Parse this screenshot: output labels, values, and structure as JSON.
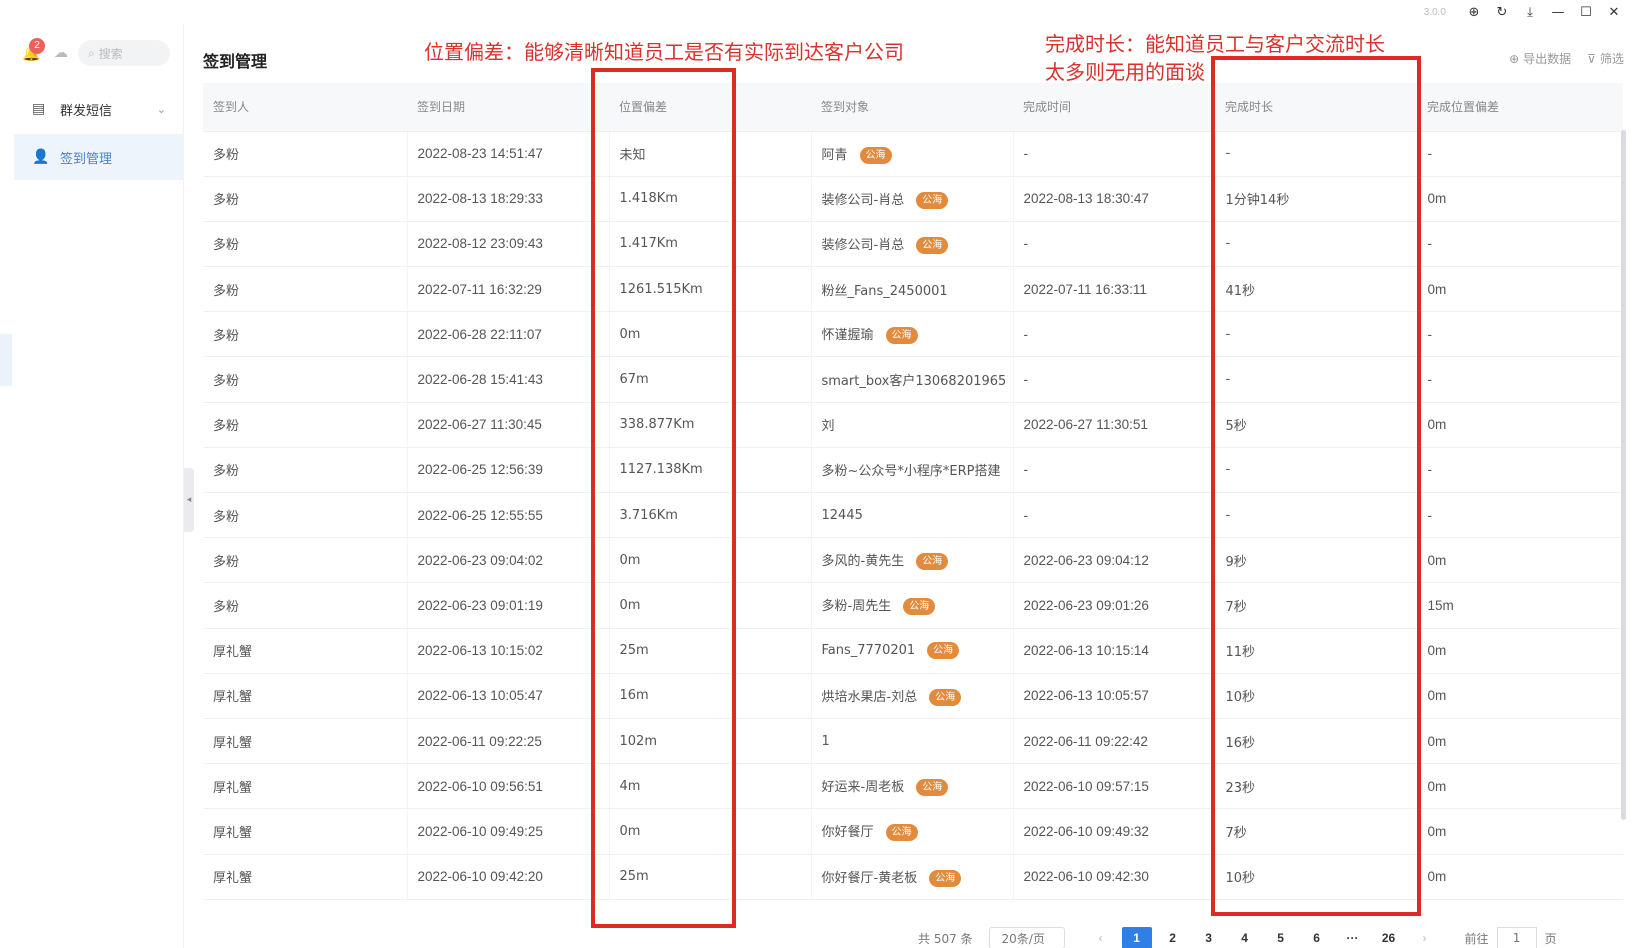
{
  "titlebar": {
    "version": "3.0.0",
    "icons": [
      "zoom-icon",
      "refresh-icon",
      "download-icon",
      "minimize-icon",
      "maximize-icon",
      "close-icon"
    ]
  },
  "sidebar": {
    "notification_count": "2",
    "search_placeholder": "搜索",
    "items": [
      {
        "label": "群发短信",
        "icon": "message-icon"
      },
      {
        "label": "签到管理",
        "icon": "user-icon"
      }
    ]
  },
  "header": {
    "title": "签到管理",
    "export_label": "导出数据",
    "filter_label": "筛选"
  },
  "annotations": {
    "note1": "位置偏差：能够清晰知道员工是否有实际到达客户公司",
    "note2_line1": "完成时长：能知道员工与客户交流时长",
    "note2_line2": "太多则无用的面谈"
  },
  "table": {
    "columns": [
      "签到人",
      "签到日期",
      "位置偏差",
      "签到对象",
      "完成时间",
      "完成时长",
      "完成位置偏差"
    ],
    "tag_label": "公海",
    "rows": [
      [
        "多粉",
        "2022-08-23 14:51:47",
        "未知",
        "阿青",
        true,
        "-",
        "-",
        "-"
      ],
      [
        "多粉",
        "2022-08-13 18:29:33",
        "1.418Km",
        "装修公司-肖总",
        true,
        "2022-08-13 18:30:47",
        "1分钟14秒",
        "0m"
      ],
      [
        "多粉",
        "2022-08-12 23:09:43",
        "1.417Km",
        "装修公司-肖总",
        true,
        "-",
        "-",
        "-"
      ],
      [
        "多粉",
        "2022-07-11 16:32:29",
        "1261.515Km",
        "粉丝_Fans_2450001",
        false,
        "2022-07-11 16:33:11",
        "41秒",
        "0m"
      ],
      [
        "多粉",
        "2022-06-28 22:11:07",
        "0m",
        "怀谨握瑜",
        true,
        "-",
        "-",
        "-"
      ],
      [
        "多粉",
        "2022-06-28 15:41:43",
        "67m",
        "smart_box客户13068201965",
        false,
        "-",
        "-",
        "-"
      ],
      [
        "多粉",
        "2022-06-27 11:30:45",
        "338.877Km",
        "刘",
        false,
        "2022-06-27 11:30:51",
        "5秒",
        "0m"
      ],
      [
        "多粉",
        "2022-06-25 12:56:39",
        "1127.138Km",
        "多粉~公众号*小程序*ERP搭建",
        false,
        "-",
        "-",
        "-"
      ],
      [
        "多粉",
        "2022-06-25 12:55:55",
        "3.716Km",
        "12445",
        false,
        "-",
        "-",
        "-"
      ],
      [
        "多粉",
        "2022-06-23 09:04:02",
        "0m",
        "多风的-黄先生",
        true,
        "2022-06-23 09:04:12",
        "9秒",
        "0m"
      ],
      [
        "多粉",
        "2022-06-23 09:01:19",
        "0m",
        "多粉-周先生",
        true,
        "2022-06-23 09:01:26",
        "7秒",
        "15m"
      ],
      [
        "厚礼蟹",
        "2022-06-13 10:15:02",
        "25m",
        "Fans_7770201",
        true,
        "2022-06-13 10:15:14",
        "11秒",
        "0m"
      ],
      [
        "厚礼蟹",
        "2022-06-13 10:05:47",
        "16m",
        "烘培水果店-刘总",
        true,
        "2022-06-13 10:05:57",
        "10秒",
        "0m"
      ],
      [
        "厚礼蟹",
        "2022-06-11 09:22:25",
        "102m",
        "1",
        false,
        "2022-06-11 09:22:42",
        "16秒",
        "0m"
      ],
      [
        "厚礼蟹",
        "2022-06-10 09:56:51",
        "4m",
        "好运来-周老板",
        true,
        "2022-06-10 09:57:15",
        "23秒",
        "0m"
      ],
      [
        "厚礼蟹",
        "2022-06-10 09:49:25",
        "0m",
        "你好餐厅",
        true,
        "2022-06-10 09:49:32",
        "7秒",
        "0m"
      ],
      [
        "厚礼蟹",
        "2022-06-10 09:42:20",
        "25m",
        "你好餐厅-黄老板",
        true,
        "2022-06-10 09:42:30",
        "10秒",
        "0m"
      ]
    ]
  },
  "pagination": {
    "total": "共 507 条",
    "page_size": "20条/页",
    "pages": [
      "1",
      "2",
      "3",
      "4",
      "5",
      "6",
      "···",
      "26"
    ],
    "current": "1",
    "goto_prefix": "前往",
    "goto_value": "1",
    "goto_suffix": "页"
  },
  "colors": {
    "annotation_red": "#dd2a25",
    "tag_orange": "#e28b3c",
    "primary_blue": "#2f7fe6"
  }
}
